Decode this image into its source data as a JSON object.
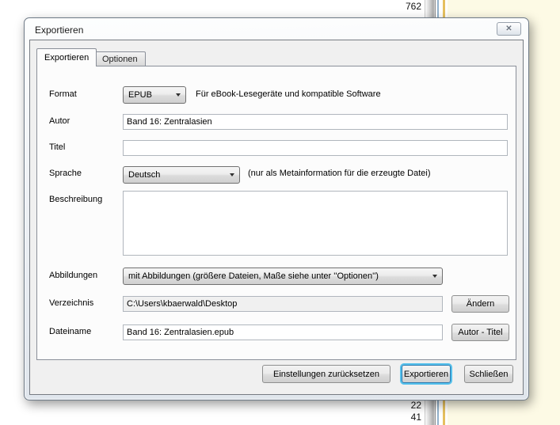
{
  "window": {
    "title": "Exportieren",
    "close_icon": "✕"
  },
  "tabs": {
    "exportieren": "Exportieren",
    "optionen": "Optionen"
  },
  "form": {
    "format": {
      "label": "Format",
      "value": "EPUB",
      "hint": "Für eBook-Lesegeräte und kompatible Software"
    },
    "autor": {
      "label": "Autor",
      "value": "Band 16: Zentralasien"
    },
    "titel": {
      "label": "Titel",
      "value": ""
    },
    "sprache": {
      "label": "Sprache",
      "value": "Deutsch",
      "hint": "(nur als Metainformation für die erzeugte Datei)"
    },
    "beschreibung": {
      "label": "Beschreibung",
      "value": ""
    },
    "abbildungen": {
      "label": "Abbildungen",
      "value": "mit Abbildungen (größere Dateien, Maße siehe unter ''Optionen'')"
    },
    "verzeichnis": {
      "label": "Verzeichnis",
      "value": "C:\\Users\\kbaerwald\\Desktop",
      "button": "Ändern"
    },
    "dateiname": {
      "label": "Dateiname",
      "value": "Band 16: Zentralasien.epub",
      "button": "Autor - Titel"
    }
  },
  "footer": {
    "reset": "Einstellungen zurücksetzen",
    "export": "Exportieren",
    "close": "Schließen"
  },
  "background": {
    "line_numbers": [
      "762",
      "22",
      "41"
    ],
    "colors": {
      "page": "#fdfae5",
      "rule_yellow": "#e6c05f",
      "rule_blue": "#93b2cc",
      "focus_ring": "#55c1ec"
    }
  }
}
